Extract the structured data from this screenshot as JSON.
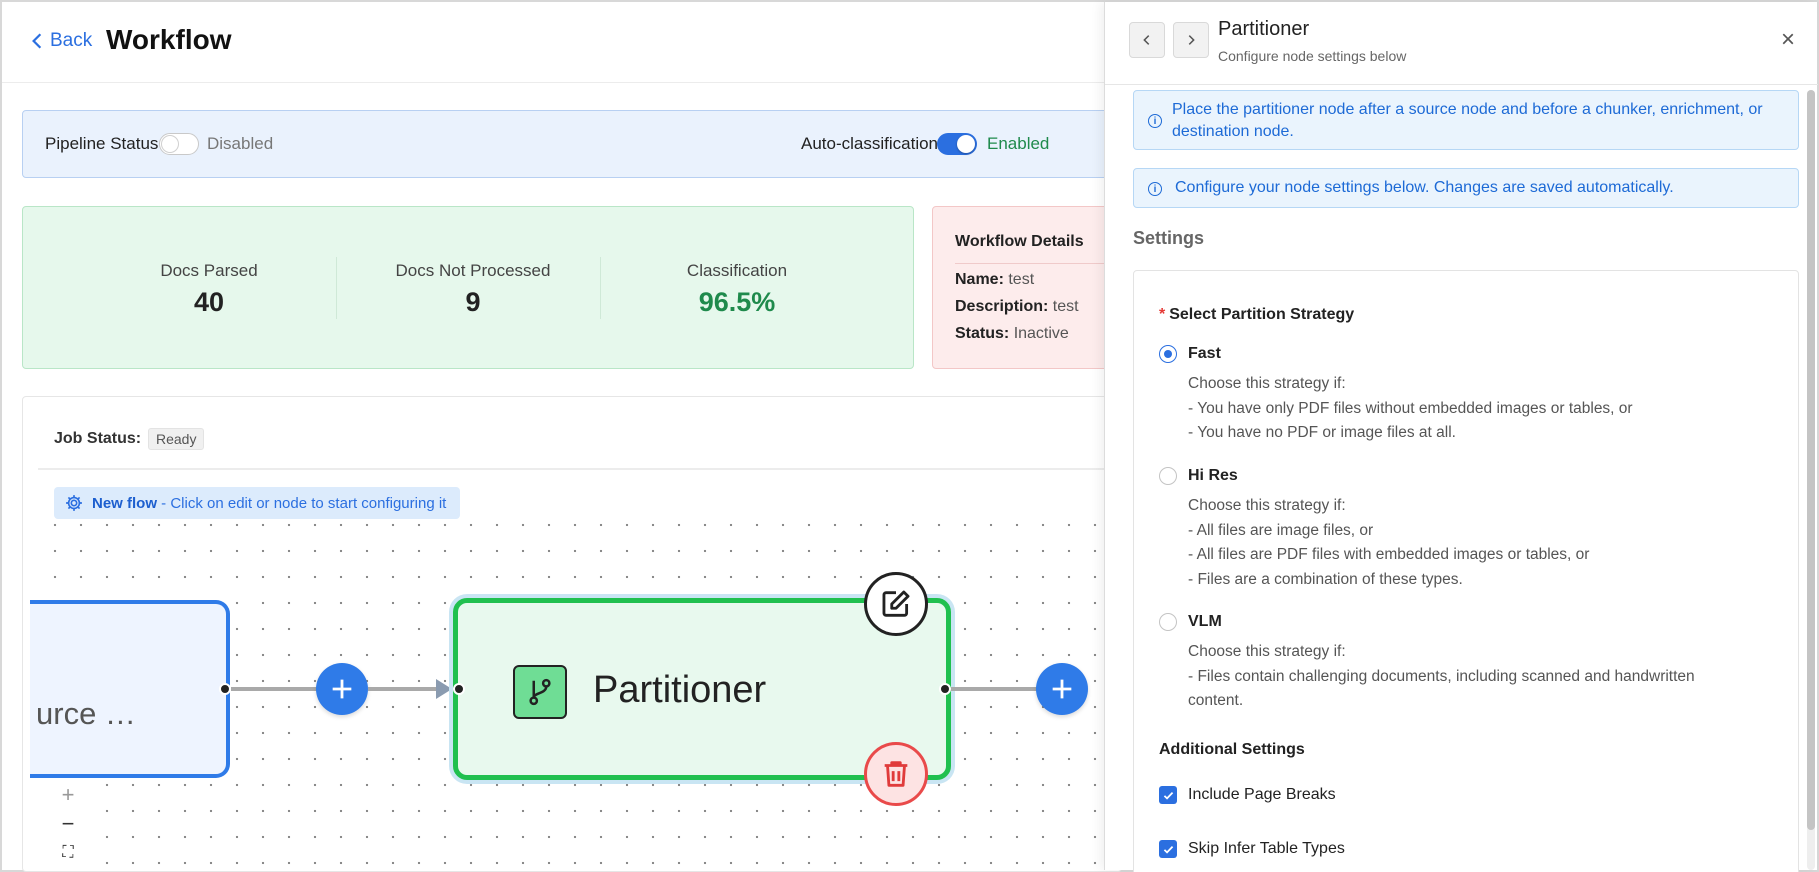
{
  "header": {
    "back_label": "Back",
    "title": "Workflow"
  },
  "status_bar": {
    "pipeline_label": "Pipeline Status",
    "pipeline_state": "Disabled",
    "autoclass_label": "Auto-classification",
    "autoclass_state": "Enabled"
  },
  "stats": {
    "parsed_label": "Docs Parsed",
    "parsed_value": "40",
    "not_processed_label": "Docs Not Processed",
    "not_processed_value": "9",
    "classification_label": "Classification",
    "classification_value": "96.5%"
  },
  "details": {
    "title": "Workflow Details",
    "name_label": "Name:",
    "name_value": "test",
    "desc_label": "Description:",
    "desc_value": "test",
    "status_label": "Status:",
    "status_value": "Inactive"
  },
  "canvas": {
    "job_label": "Job Status:",
    "job_status": "Ready",
    "new_flow_bold": "New flow",
    "new_flow_text": " - Click on edit or node to start configuring it",
    "source_node_label": "urce …",
    "partitioner_label": "Partitioner",
    "zoom_in": "+",
    "zoom_out": "−",
    "fit": "⛶"
  },
  "panel": {
    "title": "Partitioner",
    "subtitle": "Configure node settings below",
    "close": "×",
    "info1_line1": "Place the partitioner node after a source node and before a chunker, enrichment, or",
    "info1_line2": "destination node.",
    "info2": "Configure your node settings below. Changes are saved automatically.",
    "settings_heading": "Settings",
    "strategy_heading": "Select Partition Strategy",
    "required_mark": "*",
    "options": [
      {
        "label": "Fast",
        "selected": true,
        "lines": [
          "Choose this strategy if:",
          "- You have only PDF files without embedded images or tables, or",
          "- You have no PDF or image files at all."
        ]
      },
      {
        "label": "Hi Res",
        "selected": false,
        "lines": [
          "Choose this strategy if:",
          "- All files are image files, or",
          "- All files are PDF files with embedded images or tables, or",
          "- Files are a combination of these types."
        ]
      },
      {
        "label": "VLM",
        "selected": false,
        "lines": [
          "Choose this strategy if:",
          "- Files contain challenging documents, including scanned and handwritten",
          "content."
        ]
      }
    ],
    "additional_heading": "Additional Settings",
    "checks": [
      {
        "label": "Include Page Breaks",
        "checked": true
      },
      {
        "label": "Skip Infer Table Types",
        "checked": true
      }
    ]
  },
  "colors": {
    "accent": "#2b6fe0",
    "success": "#20c04f",
    "danger": "#e94a4a"
  },
  "icons": [
    "chevron-left-icon",
    "gear-icon",
    "plus-icon",
    "branch-icon",
    "edit-icon",
    "trash-icon",
    "info-icon",
    "check-icon",
    "close-icon"
  ]
}
